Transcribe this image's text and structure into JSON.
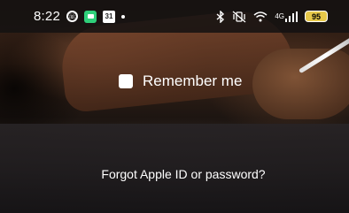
{
  "status_bar": {
    "time": "8:22",
    "calendar_day": "31",
    "network_label": "4G",
    "battery_level": "95",
    "icons": [
      "whatsapp-icon",
      "chat-icon",
      "calendar-icon",
      "notification-dot-icon",
      "bluetooth-icon",
      "vibrate-icon",
      "wifi-icon",
      "signal-icon",
      "battery-icon"
    ]
  },
  "form": {
    "remember_label": "Remember me",
    "remember_checked": false,
    "forgot_link": "Forgot Apple ID or password?"
  },
  "colors": {
    "battery": "#e6c84a",
    "chat": "#2fd07a",
    "text": "#ffffff"
  }
}
